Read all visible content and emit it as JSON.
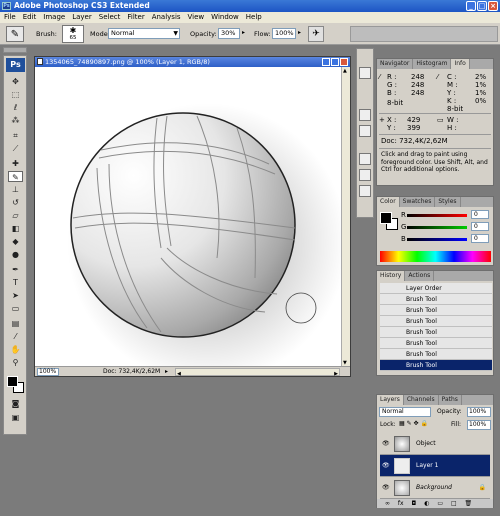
{
  "app": {
    "title": "Adobe Photoshop CS3 Extended",
    "logo": "Ps"
  },
  "menu": [
    "File",
    "Edit",
    "Image",
    "Layer",
    "Select",
    "Filter",
    "Analysis",
    "View",
    "Window",
    "Help"
  ],
  "options": {
    "brush_label": "Brush:",
    "brush_size": "65",
    "mode_label": "Mode:",
    "mode_value": "Normal",
    "opacity_label": "Opacity:",
    "opacity_value": "30%",
    "flow_label": "Flow:",
    "flow_value": "100%"
  },
  "document": {
    "title": "1354065_74890897.png @ 100% (Layer 1, RGB/8)",
    "zoom": "100%",
    "doc_info": "Doc: 732,4K/2,62M"
  },
  "info_panel": {
    "tabs": [
      "Navigator",
      "Histogram",
      "Info"
    ],
    "r_label": "R :",
    "r_value": "248",
    "g_label": "G :",
    "g_value": "248",
    "b_label": "B :",
    "b_value": "248",
    "bit_left": "8-bit",
    "c_label": "C :",
    "c_value": "2%",
    "m_label": "M :",
    "m_value": "1%",
    "y2_label": "Y :",
    "y2_value": "1%",
    "k_label": "K :",
    "k_value": "0%",
    "bit_right": "8-bit",
    "x_label": "X :",
    "x_value": "429",
    "y_label": "Y :",
    "y_value": "399",
    "w_label": "W :",
    "h_label": "H :",
    "doc_info": "Doc: 732,4K/2,62M",
    "help": "Click and drag to paint using foreground color. Use Shift, Alt, and Ctrl for additional options."
  },
  "color_panel": {
    "tabs": [
      "Color",
      "Swatches",
      "Styles"
    ],
    "r_label": "R",
    "r_value": "0",
    "g_label": "G",
    "g_value": "0",
    "b_label": "B",
    "b_value": "0"
  },
  "history_panel": {
    "tabs": [
      "History",
      "Actions"
    ],
    "items": [
      "Layer Order",
      "Brush Tool",
      "Brush Tool",
      "Brush Tool",
      "Brush Tool",
      "Brush Tool",
      "Brush Tool",
      "Brush Tool"
    ]
  },
  "layers_panel": {
    "tabs": [
      "Layers",
      "Channels",
      "Paths"
    ],
    "blend_mode": "Normal",
    "opacity_label": "Opacity:",
    "opacity_value": "100%",
    "lock_label": "Lock:",
    "fill_label": "Fill:",
    "fill_value": "100%",
    "layers": [
      "Object",
      "Layer 1",
      "Background"
    ]
  },
  "colors": {
    "titlebar": "#2458c8",
    "selection": "#0a246a",
    "panel": "#d4d0c8"
  }
}
